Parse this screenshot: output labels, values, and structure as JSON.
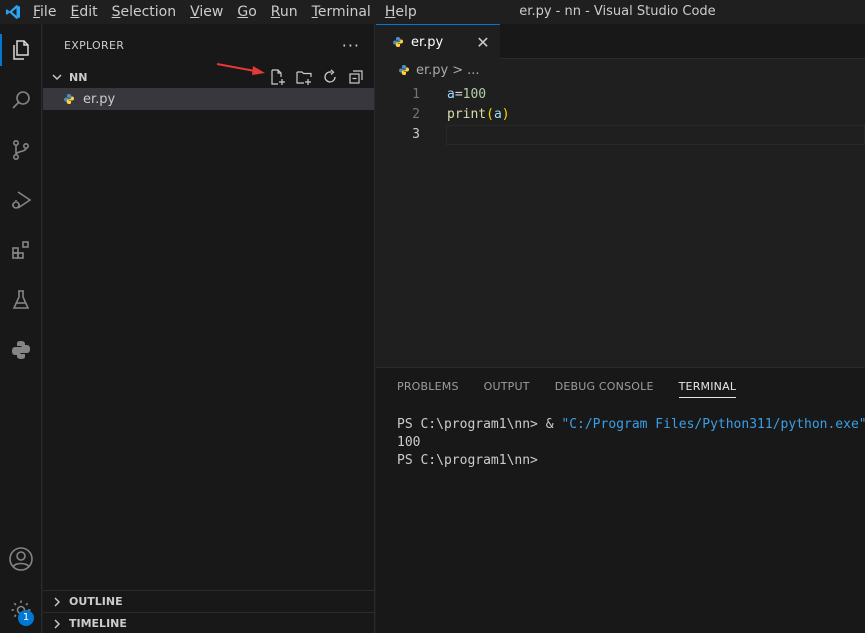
{
  "window": {
    "title": "er.py - nn - Visual Studio Code"
  },
  "menu": [
    {
      "label": "File",
      "underline": "F",
      "rest": "ile"
    },
    {
      "label": "Edit",
      "underline": "E",
      "rest": "dit"
    },
    {
      "label": "Selection",
      "underline": "S",
      "rest": "election"
    },
    {
      "label": "View",
      "underline": "V",
      "rest": "iew"
    },
    {
      "label": "Go",
      "underline": "G",
      "rest": "o"
    },
    {
      "label": "Run",
      "underline": "R",
      "rest": "un"
    },
    {
      "label": "Terminal",
      "underline": "T",
      "rest": "erminal"
    },
    {
      "label": "Help",
      "underline": "H",
      "rest": "elp"
    }
  ],
  "activity": {
    "icons": [
      "explorer-icon",
      "search-icon",
      "source-control-icon",
      "run-debug-icon",
      "extensions-icon",
      "testing-icon",
      "python-icon",
      "account-icon",
      "settings-gear-icon"
    ],
    "settings_badge": "1"
  },
  "sidebar": {
    "title": "EXPLORER",
    "more": "···",
    "folder": "NN",
    "files": [
      {
        "name": "er.py"
      }
    ],
    "sections": {
      "outline": "OUTLINE",
      "timeline": "TIMELINE"
    }
  },
  "editor": {
    "tab": {
      "label": "er.py",
      "close": "✕"
    },
    "breadcrumb": {
      "file": "er.py",
      "sep": ">",
      "rest": "..."
    },
    "lines": [
      {
        "num": "1",
        "text": "a=100"
      },
      {
        "num": "2",
        "text": "print(a)"
      },
      {
        "num": "3",
        "text": ""
      }
    ]
  },
  "panel": {
    "tabs": [
      "PROBLEMS",
      "OUTPUT",
      "DEBUG CONSOLE",
      "TERMINAL"
    ],
    "active_tab": "TERMINAL",
    "terminal": {
      "line1_prompt": "PS C:\\program1\\nn> & ",
      "line1_path": "\"C:/Program Files/Python311/python.exe\"",
      "line2": "100",
      "line3": "PS C:\\program1\\nn>"
    }
  },
  "colors": {
    "accent": "#0078d4",
    "python_blue": "#4b8bbe",
    "python_yellow": "#ffd43b",
    "annotation_red": "#e53935"
  }
}
